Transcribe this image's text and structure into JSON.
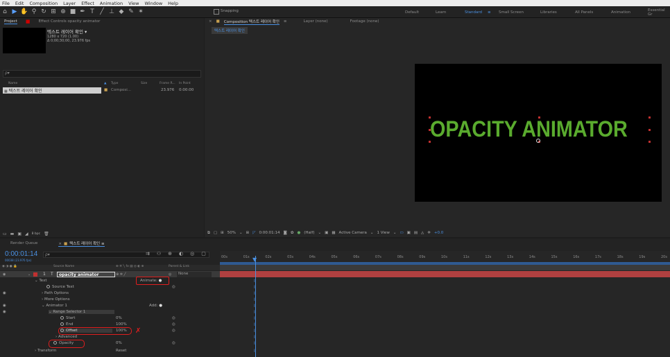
{
  "menu": [
    "File",
    "Edit",
    "Composition",
    "Layer",
    "Effect",
    "Animation",
    "View",
    "Window",
    "Help"
  ],
  "toolbar": {
    "snapping": "Snapping"
  },
  "workspaces": [
    "Default",
    "Learn",
    "Standard",
    "Small Screen",
    "Libraries",
    "All Panels",
    "Animation",
    "Essential Gr"
  ],
  "project": {
    "tab": "Project",
    "effect_controls": "Effect Controls opacity animator",
    "comp_name": "텍스트 레이어 확인 ▾",
    "comp_info1": "1280 x 720 (1.00)",
    "comp_info2": "Δ 0;00;30;00, 23.976 fps",
    "search_placeholder": "ρ▾",
    "columns": [
      "Name",
      "Type",
      "Size",
      "Frame R...",
      "In Point"
    ],
    "item": {
      "name": "텍스트 레이어 확인",
      "type": "Composi...",
      "fps": "23.976",
      "in": "0:00:00"
    },
    "bpc": "8 bpc"
  },
  "composition": {
    "tab": "Composition 텍스트 레이어 확인",
    "layer_tab": "Layer (none)",
    "footage_tab": "Footage (none)",
    "subtab": "텍스트 레이어 확인",
    "viewer_text": "OPACITY ANIMATOR",
    "text_color": "#5aab2e",
    "zoom": "50%",
    "timecode": "0:00:01:14",
    "resolution": "(Half)",
    "camera": "Active Camera",
    "view": "1 View",
    "exposure": "+0.0"
  },
  "timeline": {
    "render_tab": "Render Queue",
    "comp_tab": "텍스트 레이어 확인",
    "timecode": "0:00:01:14",
    "timecode_sub": "00038 (23.976 fps)",
    "search_placeholder": "ρ▾",
    "col_source": "Source Name",
    "col_parent": "Parent & Link",
    "layer_index": "1",
    "layer_name": "opacity animator",
    "parent": "None",
    "animate_label": "Animate:",
    "add_label": "Add:",
    "props": [
      {
        "label": "Text",
        "value": ""
      },
      {
        "label": "Source Text",
        "value": ""
      },
      {
        "label": "Path Options",
        "value": ""
      },
      {
        "label": "More Options",
        "value": ""
      },
      {
        "label": "Animator 1",
        "value": ""
      },
      {
        "label": "Range Selector 1",
        "value": ""
      },
      {
        "label": "Start",
        "value": "0%"
      },
      {
        "label": "End",
        "value": "100%"
      },
      {
        "label": "Offset",
        "value": "100%"
      },
      {
        "label": "Advanced",
        "value": ""
      },
      {
        "label": "Opacity",
        "value": "0%"
      },
      {
        "label": "Transform",
        "value": "Reset"
      }
    ],
    "ticks": [
      "00s",
      "01s",
      "02s",
      "03s",
      "04s",
      "05s",
      "06s",
      "07s",
      "08s",
      "09s",
      "10s",
      "11s",
      "12s",
      "13s",
      "14s",
      "15s",
      "16s",
      "17s",
      "18s",
      "19s",
      "20s"
    ]
  }
}
